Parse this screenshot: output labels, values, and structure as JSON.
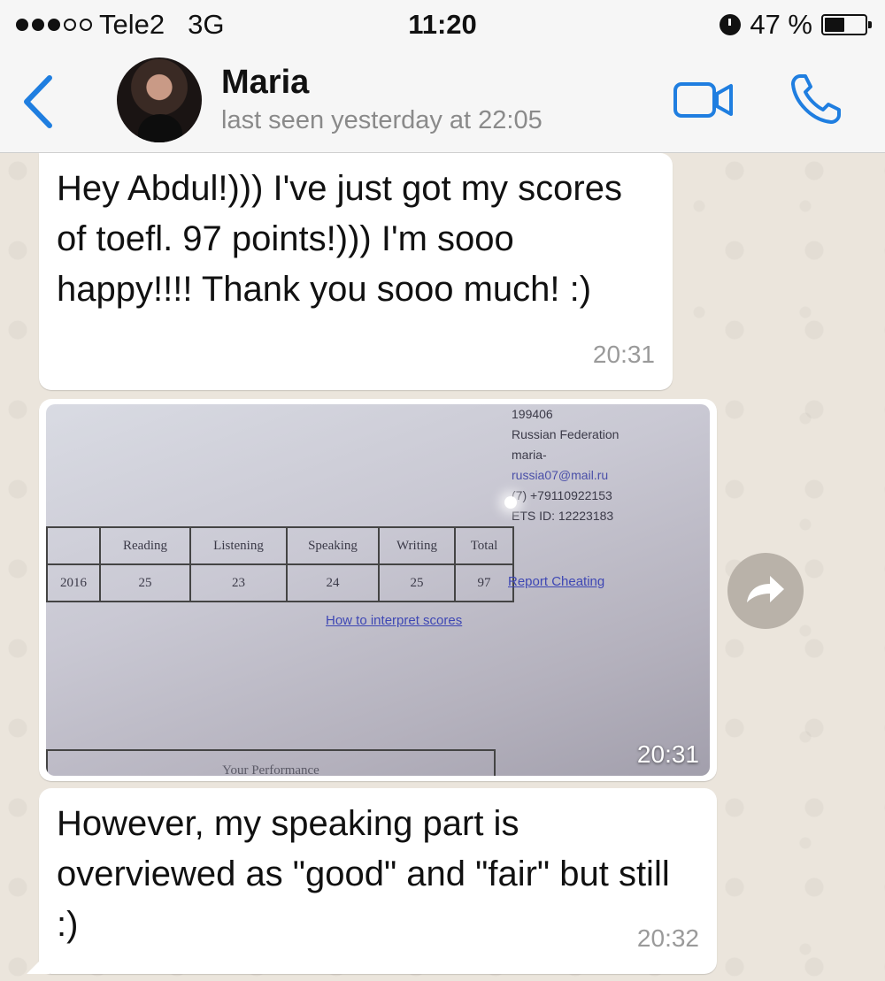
{
  "status_bar": {
    "carrier": "Tele2",
    "network": "3G",
    "time": "11:20",
    "battery": "47 %"
  },
  "header": {
    "contact_name": "Maria",
    "last_seen": "last seen yesterday at 22:05"
  },
  "messages": [
    {
      "text": "Hey Abdul!))) I've just got my scores of toefl. 97 points!))) I'm sooo happy!!!! Thank you sooo much! :)",
      "time": "20:31"
    },
    {
      "type": "photo",
      "time": "20:31",
      "photo": {
        "address_lines": [
          "199406",
          "Russian Federation",
          "maria-",
          "russia07@mail.ru",
          "(7) +79110922153",
          "ETS ID: 12223183"
        ],
        "table_headers": [
          "",
          "Reading",
          "Listening",
          "Speaking",
          "Writing",
          "Total"
        ],
        "table_row": [
          "2016",
          "25",
          "23",
          "24",
          "25",
          "97"
        ],
        "report_link": "Report Cheating",
        "interpret_link": "How to interpret scores",
        "performance_label": "Your Performance"
      }
    },
    {
      "text": "However, my speaking part is overviewed as \"good\" and \"fair\" but still :)",
      "time": "20:32"
    }
  ],
  "colors": {
    "accent": "#1f7ee0",
    "bubble": "#ffffff",
    "chat_background": "#ebe5dc"
  },
  "icons": {
    "back": "chevron-left-icon",
    "video": "video-camera-icon",
    "call": "phone-icon",
    "forward": "forward-arrow-icon"
  }
}
